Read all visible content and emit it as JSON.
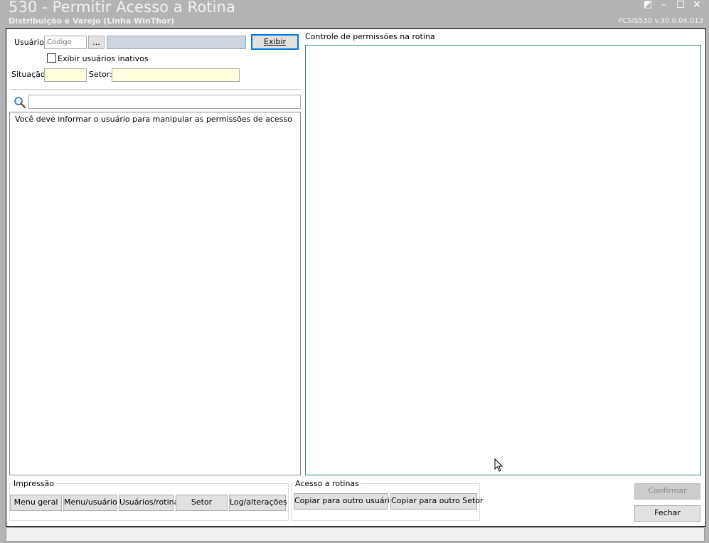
{
  "window": {
    "title": "530 - Permitir Acesso a Rotina",
    "subtitle": "Distribuição e Varejo (Linha WinThor)",
    "version": "PCSIS530  v.30.0.04.013",
    "controls": [
      "◩",
      "–",
      "☐",
      "✕"
    ]
  },
  "filters": {
    "usuario_label": "Usuário:",
    "codigo_placeholder": "Código",
    "browse_label": "...",
    "exibir_label": "Exibir",
    "inativos_label": "Exibir usuários inativos",
    "situacao_label": "Situação:",
    "setor_label": "Setor:"
  },
  "search": {
    "icon": "magnifier-icon",
    "value": ""
  },
  "user_list": {
    "message": "Você deve informar o usuário para manipular as permissões de acesso"
  },
  "permissions": {
    "title": "Controle de permissões na rotina"
  },
  "impressao": {
    "title": "Impressão",
    "buttons": [
      "Menu geral",
      "Menu/usuário",
      "Usuários/rotina",
      "Setor",
      "Log/alterações"
    ]
  },
  "acesso": {
    "title": "Acesso a rotinas",
    "buttons": [
      "Copiar para outro usuário",
      "Copiar para outro Setor"
    ]
  },
  "actions": {
    "confirmar": "Confirmar",
    "fechar": "Fechar"
  },
  "colors": {
    "title_bar": "#b4b4b4",
    "input_yellow": "#ffffe0",
    "focus_border": "#0078d7",
    "permissions_border": "#2f8080"
  }
}
